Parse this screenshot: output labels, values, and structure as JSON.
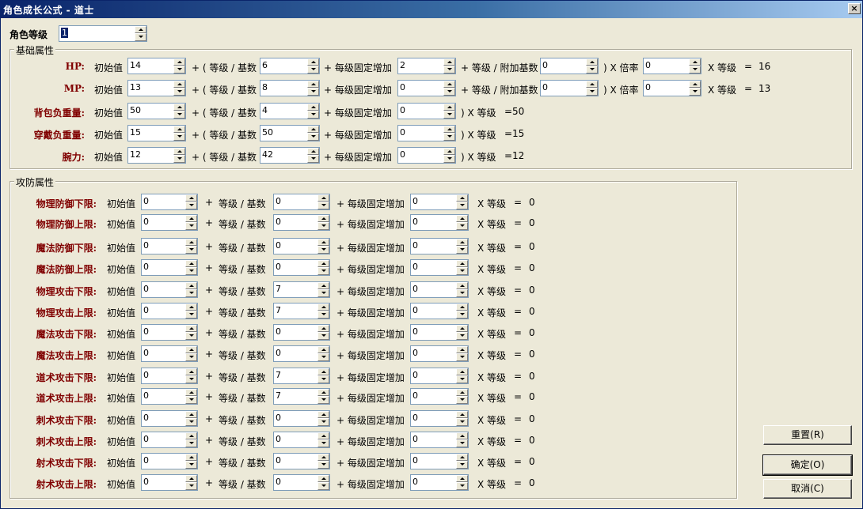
{
  "window": {
    "title": "角色成长公式 - 道士",
    "close_label": "×"
  },
  "level": {
    "label": "角色等级",
    "value": "1"
  },
  "basic": {
    "group_title": "基础属性",
    "ops": {
      "init": "初始值",
      "plus_open": "+ ( 等级 / 基数",
      "plus_fixed": "+ 每级固定增加",
      "plus_extra": "+ 等级 / 附加基数",
      "close_multiplier": ") X 倍率",
      "close_x_level": ") X 等级",
      "x_level": "X 等级",
      "equals": "="
    },
    "rows": [
      {
        "name": "HP:",
        "init": "14",
        "base": "6",
        "fixed": "2",
        "extra": "0",
        "mult": "0",
        "result": "16"
      },
      {
        "name": "MP:",
        "init": "13",
        "base": "8",
        "fixed": "0",
        "extra": "0",
        "mult": "0",
        "result": "13"
      },
      {
        "name": "背包负重量:",
        "init": "50",
        "base": "4",
        "fixed": "0",
        "result": "50"
      },
      {
        "name": "穿戴负重量:",
        "init": "15",
        "base": "50",
        "fixed": "0",
        "result": "15"
      },
      {
        "name": "腕力:",
        "init": "12",
        "base": "42",
        "fixed": "0",
        "result": "12"
      }
    ]
  },
  "combat": {
    "group_title": "攻防属性",
    "ops": {
      "init": "初始值",
      "plus": "+",
      "level_div": "等级 / 基数",
      "plus_fixed": "+ 每级固定增加",
      "x_level": "X 等级",
      "equals": "="
    },
    "rows": [
      {
        "name": "物理防御下限:",
        "init": "0",
        "base": "0",
        "fixed": "0",
        "result": "0"
      },
      {
        "name": "物理防御上限:",
        "init": "0",
        "base": "0",
        "fixed": "0",
        "result": "0"
      },
      {
        "name": "魔法防御下限:",
        "init": "0",
        "base": "0",
        "fixed": "0",
        "result": "0"
      },
      {
        "name": "魔法防御上限:",
        "init": "0",
        "base": "0",
        "fixed": "0",
        "result": "0"
      },
      {
        "name": "物理攻击下限:",
        "init": "0",
        "base": "7",
        "fixed": "0",
        "result": "0"
      },
      {
        "name": "物理攻击上限:",
        "init": "0",
        "base": "7",
        "fixed": "0",
        "result": "0"
      },
      {
        "name": "魔法攻击下限:",
        "init": "0",
        "base": "0",
        "fixed": "0",
        "result": "0"
      },
      {
        "name": "魔法攻击上限:",
        "init": "0",
        "base": "0",
        "fixed": "0",
        "result": "0"
      },
      {
        "name": "道术攻击下限:",
        "init": "0",
        "base": "7",
        "fixed": "0",
        "result": "0"
      },
      {
        "name": "道术攻击上限:",
        "init": "0",
        "base": "7",
        "fixed": "0",
        "result": "0"
      },
      {
        "name": "刺术攻击下限:",
        "init": "0",
        "base": "0",
        "fixed": "0",
        "result": "0"
      },
      {
        "name": "刺术攻击上限:",
        "init": "0",
        "base": "0",
        "fixed": "0",
        "result": "0"
      },
      {
        "name": "射术攻击下限:",
        "init": "0",
        "base": "0",
        "fixed": "0",
        "result": "0"
      },
      {
        "name": "射术攻击上限:",
        "init": "0",
        "base": "0",
        "fixed": "0",
        "result": "0"
      }
    ]
  },
  "buttons": {
    "reset": "重置(R)",
    "ok": "确定(O)",
    "cancel": "取消(C)"
  }
}
